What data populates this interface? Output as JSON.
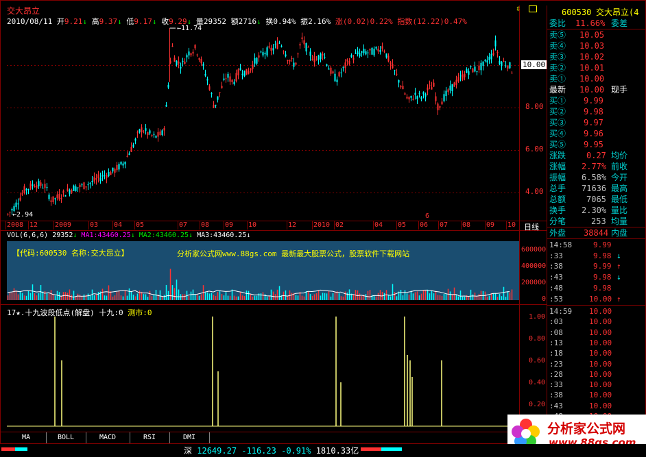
{
  "header": {
    "stock_name": "交大昂立",
    "date": "2010/08/11",
    "open_label": "开",
    "open": "9.21",
    "high_label": "高",
    "high": "9.37",
    "low_label": "低",
    "low": "9.17",
    "close_label": "收",
    "close": "9.29",
    "vol_label": "量",
    "vol": "29352",
    "amount_label": "额",
    "amount": "2716",
    "turnover_label": "换",
    "turnover": "0.94%",
    "amplitude_label": "振",
    "amplitude": "2.16%",
    "change_label": "涨",
    "change": "(0.02)",
    "change_pct": "0.22%",
    "index_label": "指数",
    "index_change": "(12.22)",
    "index_pct": "0.47%"
  },
  "price_axis": {
    "labels": [
      "10.00",
      "8.00",
      "6.00",
      "4.00"
    ],
    "values": [
      10,
      8,
      6,
      4
    ],
    "current": "10.00"
  },
  "annotations": {
    "max_label": "11.74",
    "min_label": "2.94"
  },
  "time_axis": {
    "labels": [
      "2008",
      "12",
      "2009",
      "03",
      "04",
      "05",
      "07",
      "08",
      "09",
      "10",
      "12",
      "2010",
      "02",
      "04",
      "05",
      "06",
      "07",
      "08",
      "09",
      "10"
    ],
    "period": "日线",
    "marker": "6"
  },
  "volume": {
    "header_label": "VOL(6,6,6)",
    "value": "29352",
    "ma1_label": "MA1:",
    "ma1": "43460.25",
    "ma2_label": "MA2:",
    "ma2": "43460.25",
    "ma3_label": "MA3:",
    "ma3": "43460.25",
    "axis": [
      "600000",
      "400000",
      "200000",
      "0"
    ],
    "overlay_left": "【代码:600530 名称:交大昂立】",
    "overlay_right": "分析家公式网www.88gs.com 最新最大股票公式，股票软件下载网站"
  },
  "indicator": {
    "title": "17★.十九波段低点(解盘)",
    "label1": "十九:",
    "value1": "0",
    "label2": "测市:",
    "value2": "0",
    "axis": [
      "1.00",
      "0.80",
      "0.60",
      "0.40",
      "0.20"
    ]
  },
  "tabs": [
    "MA",
    "BOLL",
    "MACD",
    "RSI",
    "DMI"
  ],
  "quote": {
    "code": "600530",
    "name": "交大昂立(4",
    "weibi_label": "委比",
    "weibi": "11.66%",
    "weicha_label": "委差",
    "asks": [
      {
        "label": "卖⑤",
        "price": "10.05"
      },
      {
        "label": "卖④",
        "price": "10.03"
      },
      {
        "label": "卖③",
        "price": "10.02"
      },
      {
        "label": "卖②",
        "price": "10.01"
      },
      {
        "label": "卖①",
        "price": "10.00"
      }
    ],
    "last_label": "最新",
    "last": "10.00",
    "now_label": "现手",
    "bids": [
      {
        "label": "买①",
        "price": "9.99"
      },
      {
        "label": "买②",
        "price": "9.98"
      },
      {
        "label": "买③",
        "price": "9.97"
      },
      {
        "label": "买④",
        "price": "9.96"
      },
      {
        "label": "买⑤",
        "price": "9.95"
      }
    ],
    "stats": [
      {
        "label": "涨跌",
        "value": "0.27",
        "right": "均价",
        "color": "#ff3232"
      },
      {
        "label": "涨幅",
        "value": "2.77%",
        "right": "前收",
        "color": "#ff3232"
      },
      {
        "label": "振幅",
        "value": "6.58%",
        "right": "今开",
        "color": "#c0c0c0"
      },
      {
        "label": "总手",
        "value": "71636",
        "right": "最高",
        "color": "#c0c0c0"
      },
      {
        "label": "总额",
        "value": "7065",
        "right": "最低",
        "color": "#c0c0c0"
      },
      {
        "label": "换手",
        "value": "2.30%",
        "right": "量比",
        "color": "#c0c0c0"
      },
      {
        "label": "分笔",
        "value": "253",
        "right": "均量",
        "color": "#c0c0c0"
      }
    ],
    "outer_label": "外盘",
    "outer": "38844",
    "inner_label": "内盘"
  },
  "ticks1": [
    {
      "time": "14:58",
      "price": "9.99",
      "arrow": ""
    },
    {
      "time": ":33",
      "price": "9.98",
      "arrow": "↓"
    },
    {
      "time": ":38",
      "price": "9.99",
      "arrow": "↑"
    },
    {
      "time": ":43",
      "price": "9.98",
      "arrow": "↓"
    },
    {
      "time": ":48",
      "price": "9.98",
      "arrow": ""
    },
    {
      "time": ":53",
      "price": "10.00",
      "arrow": "↑"
    }
  ],
  "ticks2": [
    {
      "time": "14:59",
      "price": "10.00"
    },
    {
      "time": ":03",
      "price": "10.00"
    },
    {
      "time": ":08",
      "price": "10.00"
    },
    {
      "time": ":13",
      "price": "10.00"
    },
    {
      "time": ":18",
      "price": "10.00"
    },
    {
      "time": ":23",
      "price": "10.00"
    },
    {
      "time": ":28",
      "price": "10.00"
    },
    {
      "time": ":33",
      "price": "10.00"
    },
    {
      "time": ":38",
      "price": "10.00"
    },
    {
      "time": ":43",
      "price": "10.00"
    },
    {
      "time": ":48",
      "price": "10.00"
    },
    {
      "time": ":53",
      "price": "10.00"
    }
  ],
  "status": {
    "market": "深",
    "index": "12649.27",
    "change": "-116.23",
    "pct": "-0.91%",
    "amount": "1810.33亿"
  },
  "watermark": {
    "title": "分析家公式网",
    "url": "www.88gs.com"
  },
  "colors": {
    "up": "#ff3232",
    "down": "#00ffff",
    "grid": "#800000",
    "panel_bg": "#1a4d70",
    "signal": "#ffff80"
  }
}
